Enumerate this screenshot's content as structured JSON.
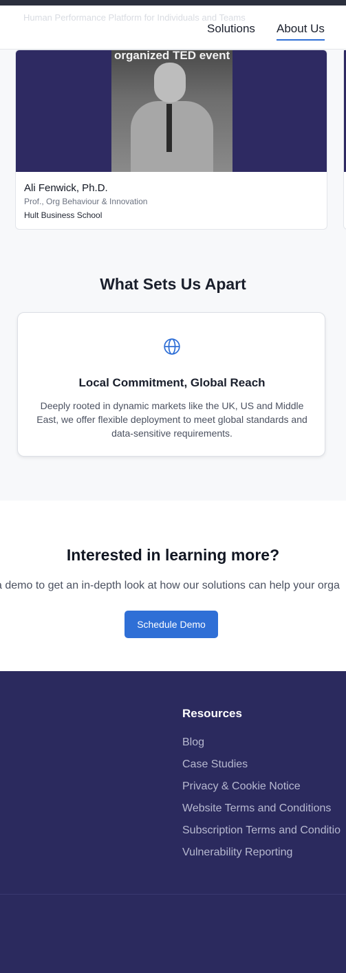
{
  "nav": {
    "ghost_text": "Human Performance Platform for Individuals and Teams",
    "links": [
      "Solutions",
      "About Us"
    ],
    "active": "About Us"
  },
  "team_card": {
    "photo_caption": "organized TED event",
    "name": "Ali Fenwick, Ph.D.",
    "role": "Prof., Org Behaviour & Innovation",
    "school": "Hult Business School"
  },
  "apart": {
    "title": "What Sets Us Apart",
    "feature": {
      "icon": "globe-icon",
      "title": "Local Commitment, Global Reach",
      "description": "Deeply rooted in dynamic markets like the UK, US and Middle East, we offer flexible deployment to meet global standards and data-sensitive requirements."
    }
  },
  "cta": {
    "title": "Interested in learning more?",
    "subtitle": "a demo to get an in-depth look at how our solutions can help your orga",
    "button_label": "Schedule Demo"
  },
  "footer": {
    "heading": "Resources",
    "links": [
      "Blog",
      "Case Studies",
      "Privacy & Cookie Notice",
      "Website Terms and Conditions",
      "Subscription Terms and Conditio",
      "Vulnerability Reporting"
    ]
  },
  "colors": {
    "accent": "#2f6fd6",
    "footer_bg": "#2b2a5e",
    "photo_bg": "#2e2a62",
    "page_bg": "#f7f8fa"
  }
}
